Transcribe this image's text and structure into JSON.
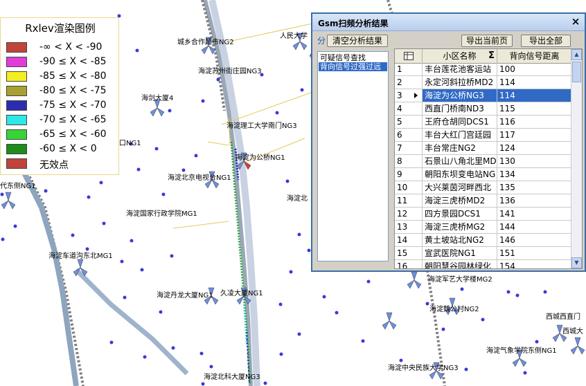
{
  "legend": {
    "title": "Rxlev渲染图例",
    "items": [
      {
        "label": "-∞ < X < -90",
        "color": "#c0443a"
      },
      {
        "label": "-90 ≤ X < -85",
        "color": "#e23cd8"
      },
      {
        "label": "-85 ≤ X < -80",
        "color": "#f4ee22"
      },
      {
        "label": "-80 ≤ X < -75",
        "color": "#a8a032"
      },
      {
        "label": "-75 ≤ X < -70",
        "color": "#2c2cb0"
      },
      {
        "label": "-70 ≤ X < -65",
        "color": "#2ce8e8"
      },
      {
        "label": "-65 ≤ X < -60",
        "color": "#36d436"
      },
      {
        "label": "-60 ≤ X < 0",
        "color": "#1d8c1d"
      },
      {
        "label": "无效点",
        "color": "#c0443a"
      }
    ]
  },
  "map_labels": [
    "城乡合作超市NG2",
    "人民大学",
    "海淀苏州街庄园NG3",
    "海淀理工大学南门NG3",
    "海淀为公桥NG1",
    "海淀北京电视台NG1",
    "海淀北",
    "海淀国家行政学院MG1",
    "海淀车道沟东北MG1",
    "海淀丹龙大厦NG1",
    "久凌大厦NG1",
    "海淀军艺大学楼MG2",
    "海淀魏公村NG2",
    "西城西直门",
    "西城大",
    "海淀气象学院东侧NG1",
    "海淀中央民族大学NG3",
    "海淀北科大厦NG3",
    "海剑大厦4",
    "口NG1",
    "代东侧NG1"
  ],
  "dialog": {
    "title": "Gsm扫频分析结果",
    "close_glyph": "×",
    "pane_label": "分",
    "clear_button": "清空分析结果",
    "export_page_button": "导出当前页",
    "export_all_button": "导出全部",
    "list_items": [
      "可疑信号查找",
      "背向信号过强过远"
    ],
    "columns": {
      "name": "小区名称",
      "dist": "背向信号距离",
      "sigma": "Σ",
      "corner_icon": "grid-icon"
    },
    "rows": [
      {
        "idx": "1",
        "name": "丰台莲花池客运站",
        "dist": "100"
      },
      {
        "idx": "2",
        "name": "永定河斜拉桥MD2",
        "dist": "114"
      },
      {
        "idx": "3",
        "name": "海淀为公桥NG3",
        "dist": "114",
        "selected": true
      },
      {
        "idx": "4",
        "name": "西直门桥南ND3",
        "dist": "115"
      },
      {
        "idx": "5",
        "name": "王府仓胡同DCS1",
        "dist": "116"
      },
      {
        "idx": "6",
        "name": "丰台大红门宫廷园",
        "dist": "117"
      },
      {
        "idx": "7",
        "name": "丰台常庄NG2",
        "dist": "124"
      },
      {
        "idx": "8",
        "name": "石景山八角北里MD",
        "dist": "130"
      },
      {
        "idx": "9",
        "name": "朝阳东坝变电站NG",
        "dist": "134"
      },
      {
        "idx": "10",
        "name": "大兴莱茵河畔西北",
        "dist": "135"
      },
      {
        "idx": "11",
        "name": "海淀三虎桥MD2",
        "dist": "136"
      },
      {
        "idx": "12",
        "name": "四方景园DCS1",
        "dist": "141"
      },
      {
        "idx": "13",
        "name": "海淀三虎桥MG2",
        "dist": "144"
      },
      {
        "idx": "14",
        "name": "黄土坡站北NG2",
        "dist": "146"
      },
      {
        "idx": "15",
        "name": "宣武医院NG1",
        "dist": "151"
      },
      {
        "idx": "16",
        "name": "朝阳慧谷园林绿化",
        "dist": "154"
      }
    ]
  }
}
